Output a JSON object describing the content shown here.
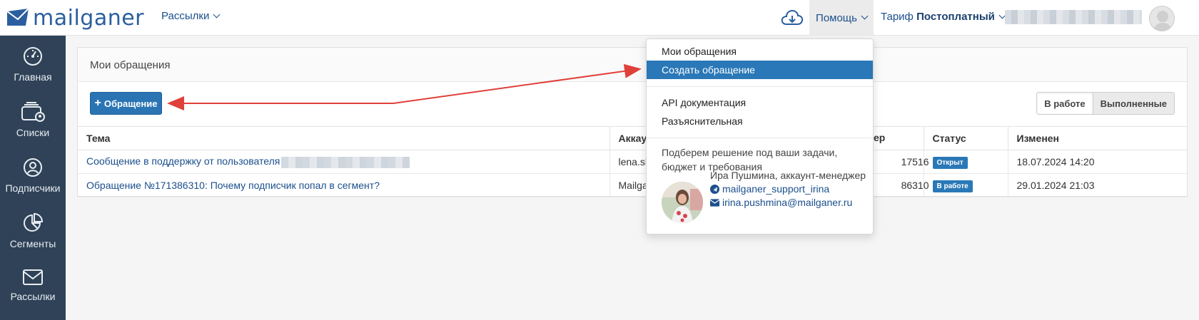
{
  "topbar": {
    "logo_text": "mailganer",
    "nav_mailings": "Рассылки",
    "help": "Помощь",
    "tariff_label": "Тариф",
    "tariff_value": "Постоплатный"
  },
  "sidebar": {
    "items": [
      {
        "label": "Главная",
        "icon": "dashboard-icon"
      },
      {
        "label": "Списки",
        "icon": "contacts-list-icon"
      },
      {
        "label": "Подписчики",
        "icon": "user-icon"
      },
      {
        "label": "Сегменты",
        "icon": "pie-chart-icon"
      },
      {
        "label": "Рассылки",
        "icon": "envelope-icon"
      }
    ]
  },
  "panel": {
    "title": "Мои обращения",
    "new_button": "Обращение",
    "filter_active": "В работе",
    "filter_done": "Выполненные",
    "columns": [
      "Тема",
      "Аккаунт",
      "Номер",
      "Статус",
      "Изменен"
    ],
    "column_fragments": {
      "account": "Аккаун",
      "number": "ер"
    },
    "rows": [
      {
        "topic": "Сообщение в поддержку от пользователя",
        "account": "lena.sh",
        "number": "17516",
        "status": "Открыт",
        "status_color": "#2a78b7",
        "changed": "18.07.2024 14:20"
      },
      {
        "topic": "Обращение №171386310: Почему подписчик попал в сегмент?",
        "account": "Mailga",
        "number": "86310",
        "status": "В работе",
        "status_color": "#2a78b7",
        "changed": "29.01.2024 21:03"
      }
    ]
  },
  "dropdown": {
    "items": [
      "Мои обращения",
      "Создать обращение",
      "API документация",
      "Разъяснительная"
    ],
    "active_index": 1,
    "promo_line1": "Подберем решение под ваши задачи,",
    "promo_line2": "бюджет и требования",
    "manager_name": "Ира Пушмина, аккаунт-менеджер",
    "telegram": "mailganer_support_irina",
    "email": "irina.pushmina@mailganer.ru"
  },
  "colors": {
    "accent": "#2a74b4",
    "sidebar_bg": "#2f4257",
    "annotation_arrow": "#e0403a"
  }
}
